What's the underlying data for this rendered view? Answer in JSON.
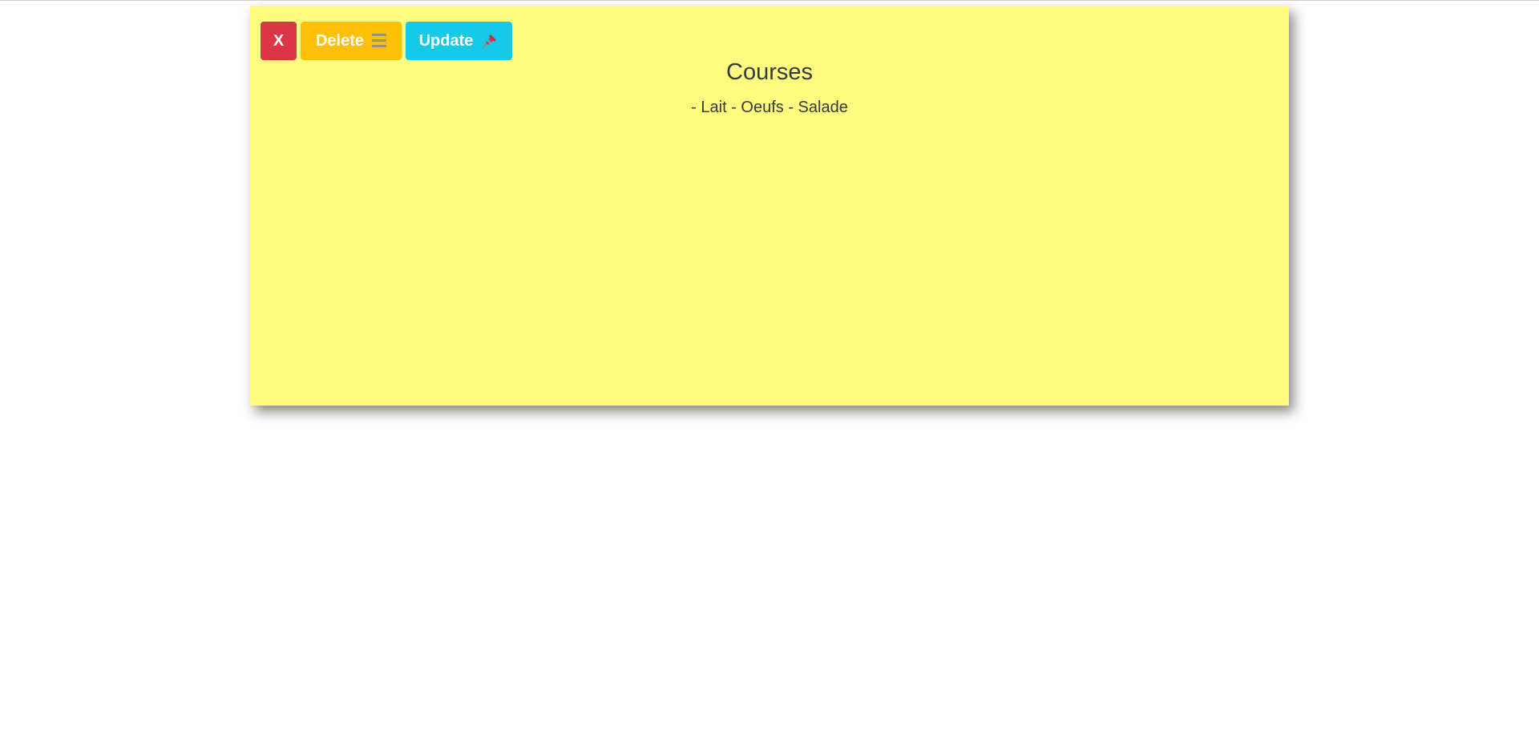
{
  "note": {
    "title": "Courses",
    "content": "- Lait - Oeufs - Salade",
    "background_color": "#fefb7e"
  },
  "toolbar": {
    "close_label": "X",
    "delete_label": "Delete",
    "delete_icon": "trash-icon",
    "update_label": "Update",
    "update_icon": "pushpin-icon",
    "colors": {
      "close": "#dc3545",
      "delete": "#ffc107",
      "update": "#17c9e8"
    }
  }
}
